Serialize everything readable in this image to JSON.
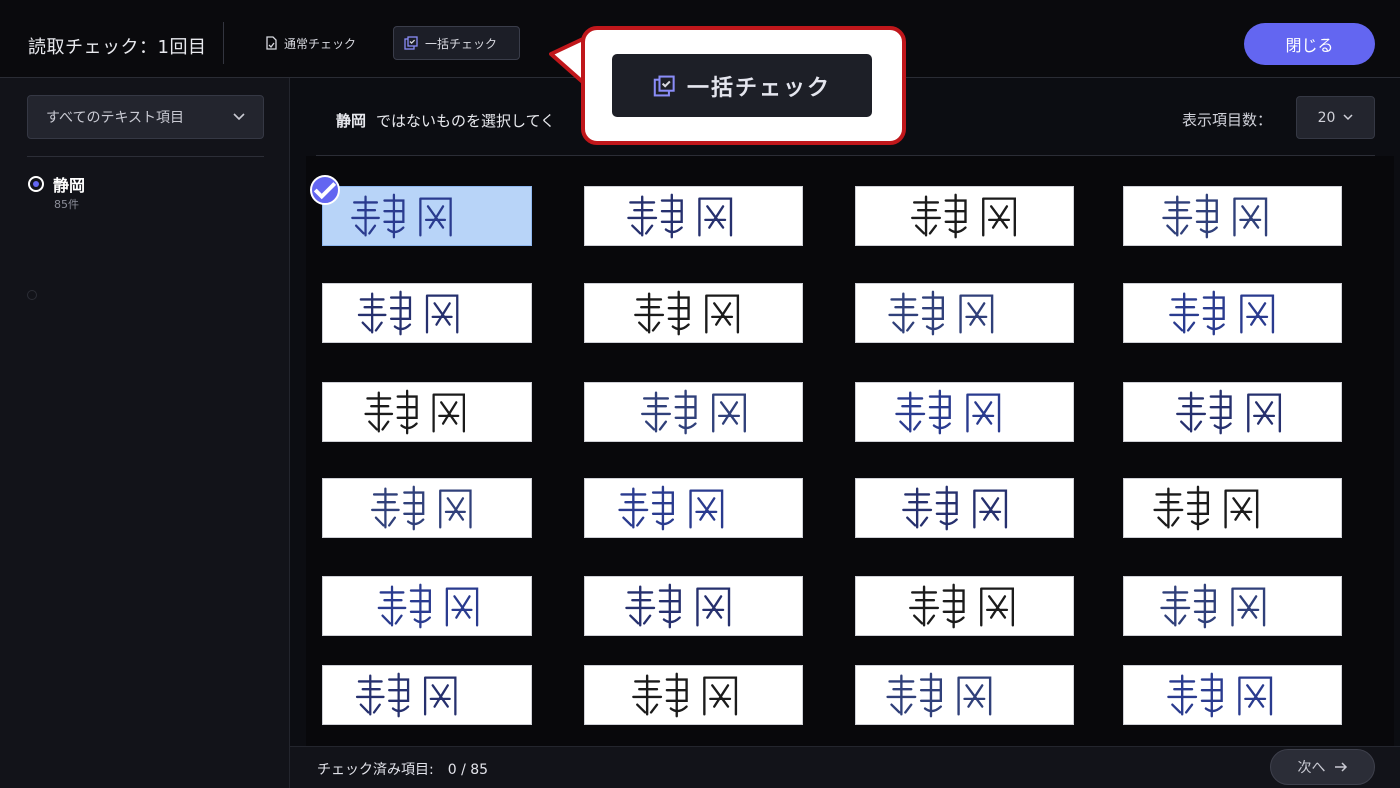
{
  "header": {
    "title": "読取チェック：1回目",
    "mode_normal_label": "通常チェック",
    "mode_batch_label": "一括チェック",
    "close_label": "閉じる"
  },
  "sidebar": {
    "filter_label": "すべてのテキスト項目",
    "fields": [
      {
        "name": "静岡",
        "count": "85件"
      }
    ]
  },
  "main": {
    "instruction_target": "静岡",
    "instruction_text": "ではないものを選択してく",
    "display_count_label": "表示項目数：",
    "display_count_value": "20",
    "selected_cells": [
      0
    ],
    "progress_label": "チェック済み項目:",
    "progress_value": "0 / 85",
    "next_label": "次へ"
  },
  "callout": {
    "label": "一括チェック"
  },
  "colors": {
    "accent": "#6366f1",
    "callout_border": "#c0171b",
    "selected_cell": "#b8d4f8"
  }
}
